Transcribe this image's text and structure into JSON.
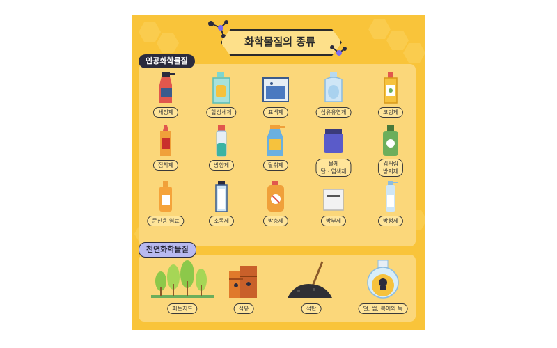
{
  "title": "화학물질의 종류",
  "sections": {
    "artificial": {
      "label": "인공화학물질",
      "items": [
        {
          "label": "세정제",
          "icon": "spray-bottle-icon"
        },
        {
          "label": "합성세제",
          "icon": "detergent-bottle-icon"
        },
        {
          "label": "표백제",
          "icon": "bleach-box-icon"
        },
        {
          "label": "섬유유연제",
          "icon": "softener-bottle-icon"
        },
        {
          "label": "코팅제",
          "icon": "coating-bottle-icon"
        },
        {
          "label": "접착제",
          "icon": "glue-bottle-icon"
        },
        {
          "label": "방향제",
          "icon": "air-freshener-icon"
        },
        {
          "label": "탈취제",
          "icon": "deodorizer-spray-icon"
        },
        {
          "label": "물체\n탈 · 염색제",
          "icon": "dye-jar-icon"
        },
        {
          "label": "김서림\n방지제",
          "icon": "antifog-bottle-icon"
        },
        {
          "label": "문신용 염료",
          "icon": "tattoo-ink-icon"
        },
        {
          "label": "소독제",
          "icon": "disinfectant-bottle-icon"
        },
        {
          "label": "방충제",
          "icon": "insect-repellent-icon"
        },
        {
          "label": "방부제",
          "icon": "preservative-box-icon"
        },
        {
          "label": "방청제",
          "icon": "rust-inhibitor-spray-icon"
        }
      ]
    },
    "natural": {
      "label": "천연화학물질",
      "items": [
        {
          "label": "피톤치드",
          "icon": "trees-icon"
        },
        {
          "label": "석유",
          "icon": "oil-barrels-icon"
        },
        {
          "label": "석탄",
          "icon": "coal-shovel-icon"
        },
        {
          "label": "벌, 뱀, 복어의 독",
          "icon": "poison-flask-icon"
        }
      ]
    }
  },
  "colors": {
    "background": "#f9c43a",
    "panel": "#fbd77a",
    "label_bg": "#ffe59a",
    "dark": "#2b2b3d",
    "accent_light": "#b8b9f0"
  }
}
